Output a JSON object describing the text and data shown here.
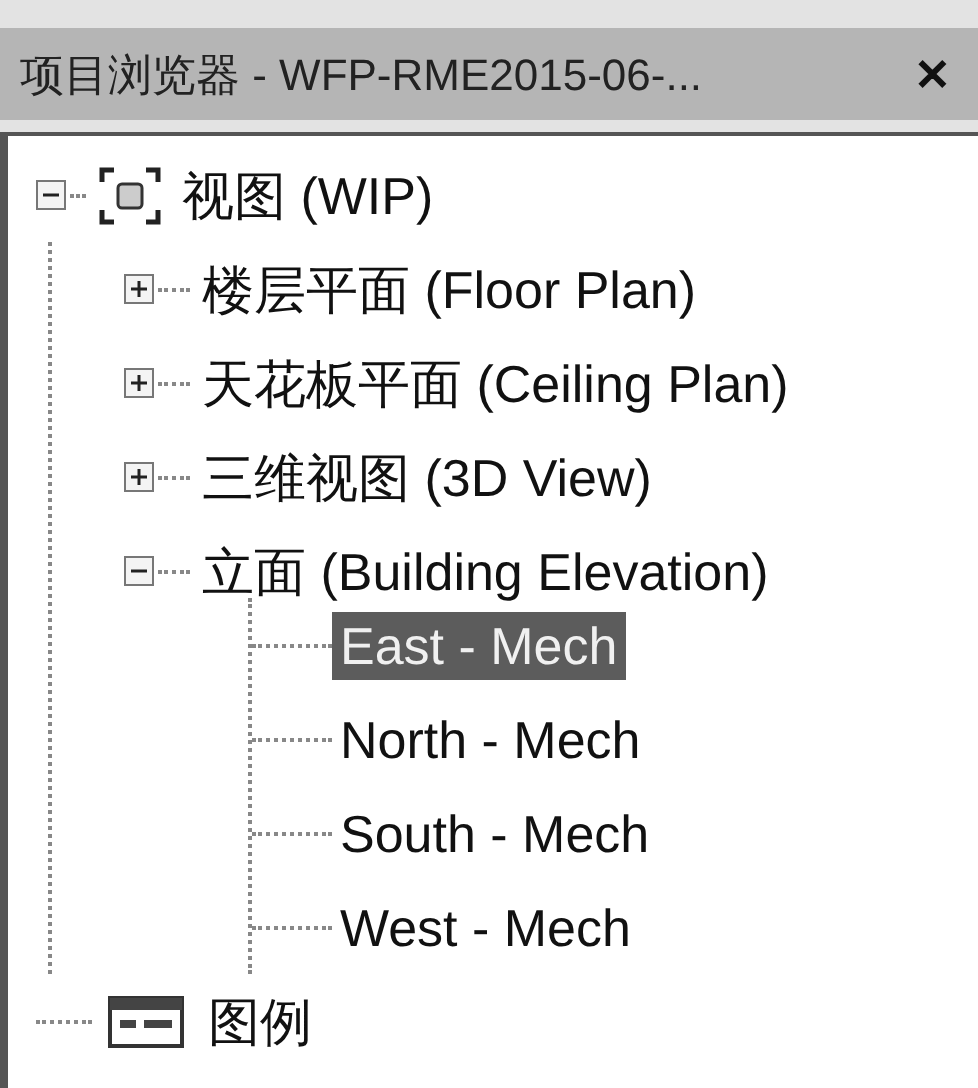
{
  "window": {
    "title": "项目浏览器 - WFP-RME2015-06-...",
    "close": "✕"
  },
  "tree": [
    {
      "label": "视图 (WIP)",
      "kind": "views",
      "expanded": true,
      "children": [
        {
          "label": "楼层平面 (Floor Plan)",
          "expanded": false
        },
        {
          "label": "天花板平面 (Ceiling Plan)",
          "expanded": false
        },
        {
          "label": "三维视图 (3D View)",
          "expanded": false
        },
        {
          "label": "立面 (Building Elevation)",
          "expanded": true,
          "children": [
            {
              "label": "East - Mech",
              "selected": true
            },
            {
              "label": "North - Mech",
              "selected": false
            },
            {
              "label": "South - Mech",
              "selected": false
            },
            {
              "label": "West - Mech",
              "selected": false
            }
          ]
        }
      ]
    },
    {
      "label": "图例",
      "kind": "legend"
    }
  ]
}
